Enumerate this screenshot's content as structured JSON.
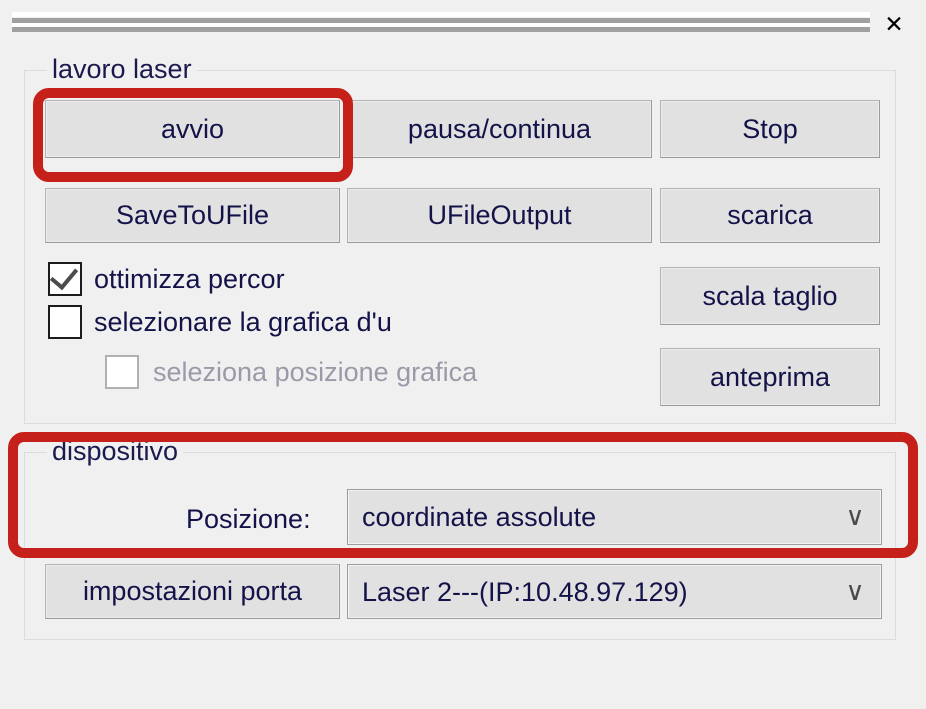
{
  "window": {
    "close_label": "✕"
  },
  "groups": {
    "laser_job": {
      "title": "lavoro laser",
      "buttons": [
        {
          "id": "avvio",
          "label": "avvio"
        },
        {
          "id": "pausa",
          "label": "pausa/continua"
        },
        {
          "id": "stop",
          "label": "Stop"
        },
        {
          "id": "savetoufile",
          "label": "SaveToUFile"
        },
        {
          "id": "ufileoutput",
          "label": "UFileOutput"
        },
        {
          "id": "scarica",
          "label": "scarica"
        },
        {
          "id": "scalataglio",
          "label": "scala taglio"
        },
        {
          "id": "anteprima",
          "label": "anteprima"
        }
      ],
      "checkboxes": [
        {
          "id": "ottimizza",
          "label": "ottimizza percor",
          "checked": true,
          "enabled": true
        },
        {
          "id": "selezionare_grafica",
          "label": "selezionare la grafica d'u",
          "checked": false,
          "enabled": true
        },
        {
          "id": "seleziona_posizione",
          "label": "seleziona posizione grafica",
          "checked": false,
          "enabled": false
        }
      ]
    },
    "device": {
      "title": "dispositivo",
      "position_label": "Posizione:",
      "position_value": "coordinate assolute",
      "port_settings_label": "impostazioni porta",
      "laser_value": "Laser 2---(IP:10.48.97.129)",
      "chevron": "∨"
    }
  },
  "annotations": {
    "highlight_color": "#c5201a",
    "boxes": [
      {
        "id": "avvio-highlight",
        "target": "avvio"
      },
      {
        "id": "dispositivo-highlight",
        "target": "dispositivo"
      }
    ]
  }
}
